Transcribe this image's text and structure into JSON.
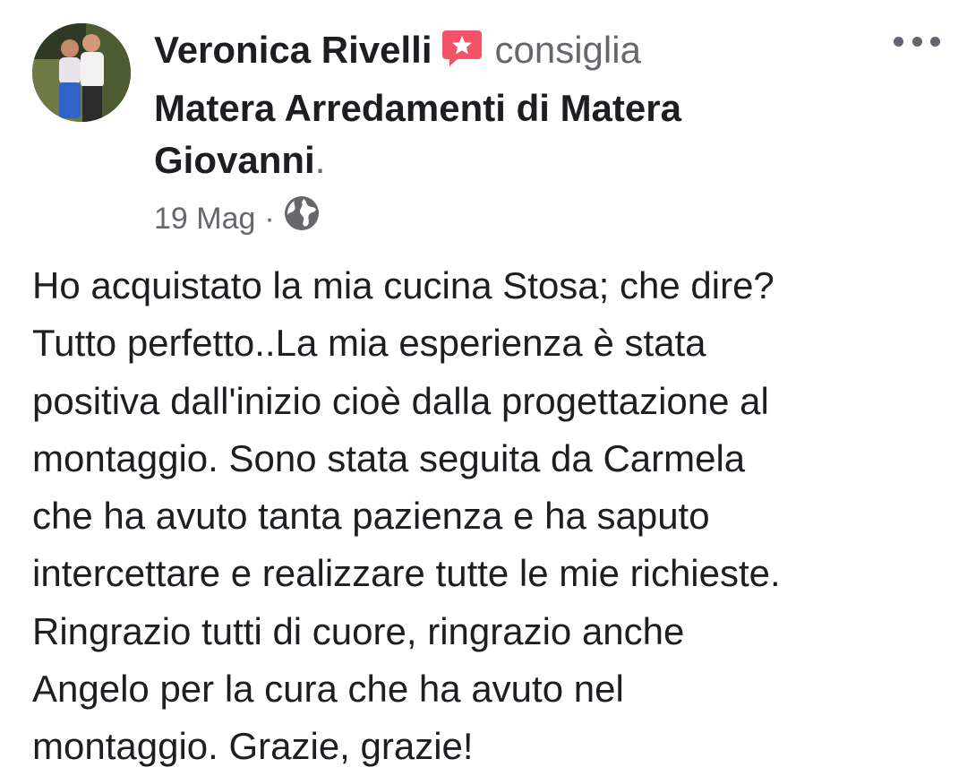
{
  "post": {
    "author": "Veronica Rivelli",
    "action": "consiglia",
    "page_name": "Matera Arredamenti di Matera Giovanni",
    "page_name_suffix": ".",
    "date": "19 Mag",
    "separator": "·",
    "privacy_icon": "globe-icon",
    "badge_icon": "recommend-badge-icon",
    "badge_color": "#f35369",
    "more_icon": "more-options-icon",
    "body_lines": [
      "Ho acquistato la mia cucina Stosa; che dire?",
      "Tutto perfetto..La mia esperienza è stata",
      "positiva dall'inizio cioè dalla progettazione al",
      "montaggio. Sono stata seguita da Carmela",
      "che ha avuto tanta pazienza e ha saputo",
      "intercettare e realizzare tutte le mie richieste.",
      "Ringrazio tutti di cuore, ringrazio anche",
      "Angelo per la cura che ha avuto nel",
      "montaggio. Grazie, grazie!"
    ]
  }
}
